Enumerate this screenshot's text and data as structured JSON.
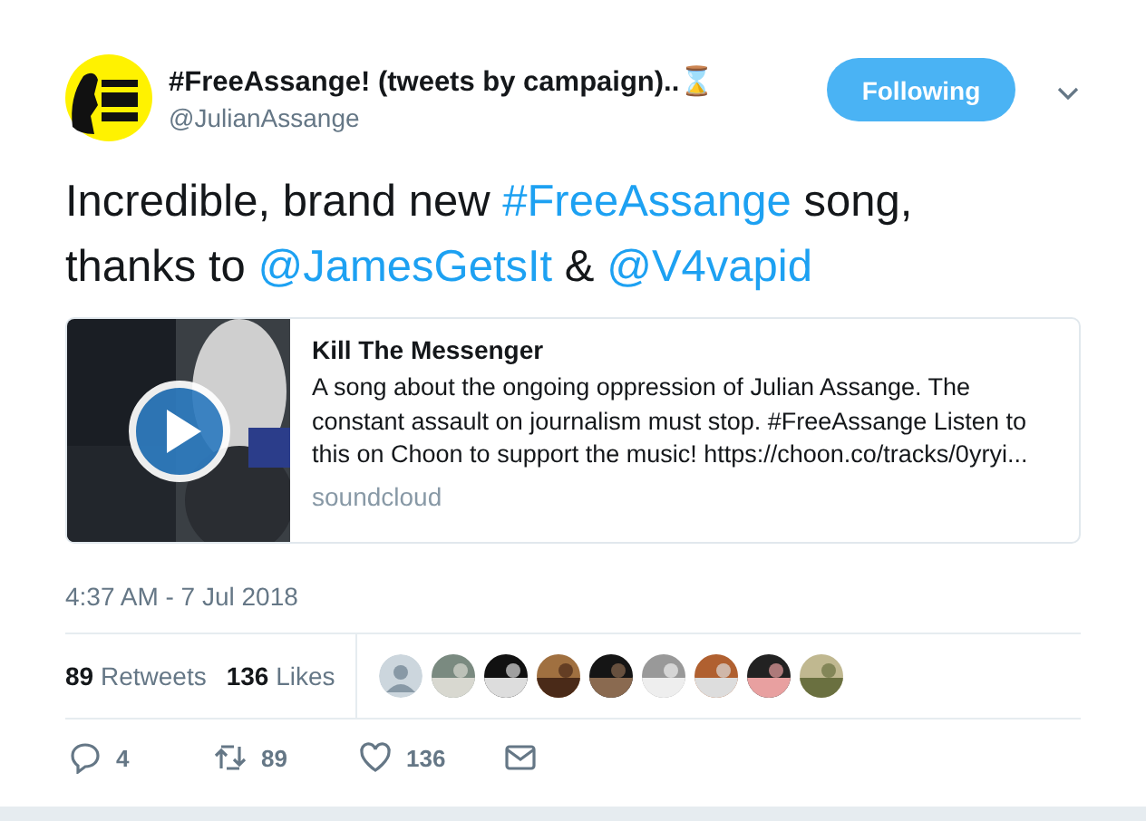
{
  "author": {
    "name": "#FreeAssange! (tweets by campaign)..⌛",
    "handle": "@JulianAssange",
    "avatar": {
      "kind": "picture"
    }
  },
  "follow_button": {
    "label": "Following",
    "following": true
  },
  "tweet_text": [
    {
      "kind": "plain",
      "text": "Incredible, brand new "
    },
    {
      "kind": "link",
      "text": "#FreeAssange"
    },
    {
      "kind": "plain",
      "text": " song, thanks to "
    },
    {
      "kind": "link",
      "text": "@JamesGetsIt"
    },
    {
      "kind": "plain",
      "text": " & "
    },
    {
      "kind": "link",
      "text": "@V4vapid"
    }
  ],
  "card": {
    "title": "Kill The Messenger",
    "description": "A song about the ongoing oppression of Julian Assange. The constant assault on journalism must stop. #FreeAssange Listen to this on Choon to support the music! https://choon.co/tracks/0yryi...",
    "source": "soundcloud",
    "media": {
      "kind": "picture"
    }
  },
  "timestamp": "4:37 AM - 7 Jul 2018",
  "stats": [
    {
      "count": "89",
      "label": "Retweets"
    },
    {
      "count": "136",
      "label": "Likes"
    }
  ],
  "likers": [
    {
      "kind": "default"
    },
    {
      "kind": "picture"
    },
    {
      "kind": "picture"
    },
    {
      "kind": "picture"
    },
    {
      "kind": "picture"
    },
    {
      "kind": "picture"
    },
    {
      "kind": "picture"
    },
    {
      "kind": "picture"
    },
    {
      "kind": "picture"
    }
  ],
  "actions": [
    {
      "kind": "reply",
      "count": "4"
    },
    {
      "kind": "retweet",
      "count": "89"
    },
    {
      "kind": "like",
      "count": "136"
    },
    {
      "kind": "message"
    }
  ]
}
